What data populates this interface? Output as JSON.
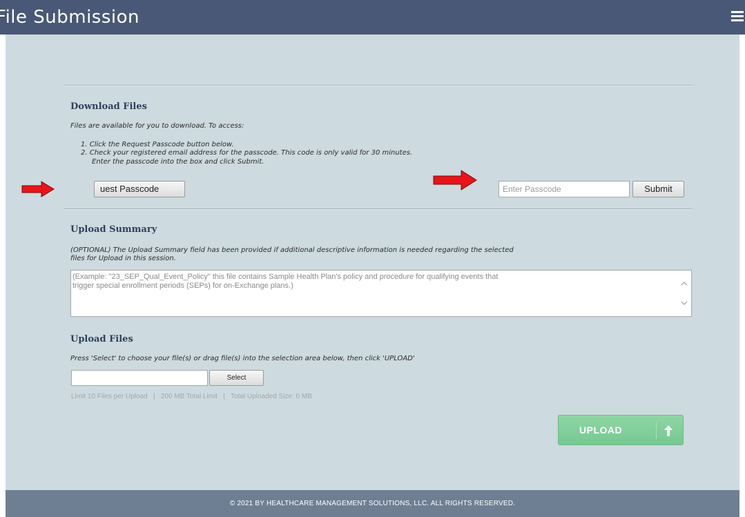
{
  "header": {
    "title": "File Submission",
    "menu_icon": "hamburger-menu-icon"
  },
  "download": {
    "heading": "Download Files",
    "intro": "Files are available for you to download. To access:",
    "steps": [
      "1.  Click the Request Passcode button below.",
      "2.  Check your registered email address for the passcode. This code is only valid for 30 minutes.",
      "Enter the passcode into the box and click Submit."
    ],
    "request_button": "uest Passcode",
    "passcode_placeholder": "Enter Passcode",
    "submit_button": "Submit"
  },
  "summary": {
    "heading": "Upload Summary",
    "description_line1": "(OPTIONAL) The Upload Summary field has been provided if additional descriptive information is needed regarding the selected",
    "description_line2": "files for Upload in this session.",
    "textarea_line1": "(Example:  \"23_SEP_Qual_Event_Policy\" this file contains Sample Health Plan's policy and procedure for qualifying events that",
    "textarea_line2": "trigger special enrollment periods (SEPs) for on-Exchange plans.)"
  },
  "upload": {
    "heading": "Upload Files",
    "instruction": "Press 'Select' to choose your file(s) or drag file(s) into the selection area below, then click 'UPLOAD'",
    "file_value": "",
    "select_button": "Select",
    "limits": "Limit 10 Files per Upload   |   200 MB Total Limit   |   Total Uploaded Size: 0 MB",
    "upload_button": "UPLOAD",
    "upload_icon": "up-arrow-icon"
  },
  "footer": {
    "text": "© 2021 BY HEALTHCARE MANAGEMENT SOLUTIONS, LLC. ALL RIGHTS RESERVED."
  },
  "colors": {
    "header_bg": "#4a5877",
    "panel_bg": "#cddadf",
    "footer_bg": "#6f7f93",
    "heading": "#2f3f5a",
    "upload_green": "#7fcf98",
    "annotation_arrow": "#e8141a"
  }
}
